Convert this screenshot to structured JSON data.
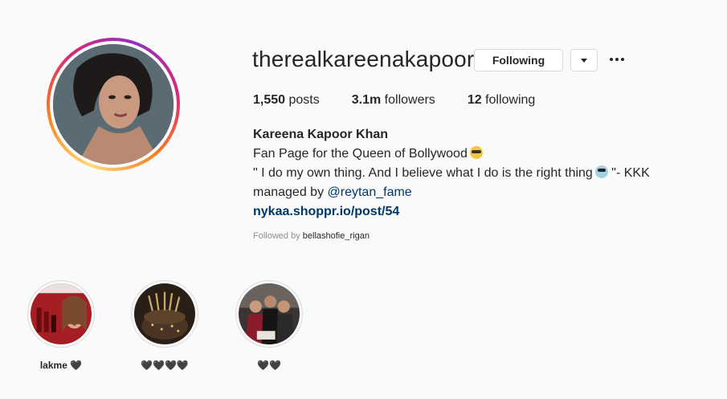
{
  "profile": {
    "username": "therealkareenakapoor",
    "following_button": "Following",
    "dropdown_icon": "chevron-down-icon",
    "more_icon": "more-options-icon"
  },
  "stats": {
    "posts_count": "1,550",
    "posts_label": "posts",
    "followers_count": "3.1m",
    "followers_label": "followers",
    "following_count": "12",
    "following_label": "following"
  },
  "bio": {
    "full_name": "Kareena Kapoor Khan",
    "line1": "Fan Page for the Queen of Bollywood",
    "line2": "\" I do my own thing. And I believe what I do is the right thing",
    "line2_tail": "\"- KKK",
    "line3_prefix": "managed by",
    "mention": "@reytan_fame",
    "link": "nykaa.shoppr.io/post/54"
  },
  "followed_by": {
    "prefix": "Followed by",
    "user": "bellashofie_rigan"
  },
  "highlights": [
    {
      "label": "lakme 🖤"
    },
    {
      "label": "🖤🖤🖤🖤"
    },
    {
      "label": "🖤🖤"
    }
  ]
}
